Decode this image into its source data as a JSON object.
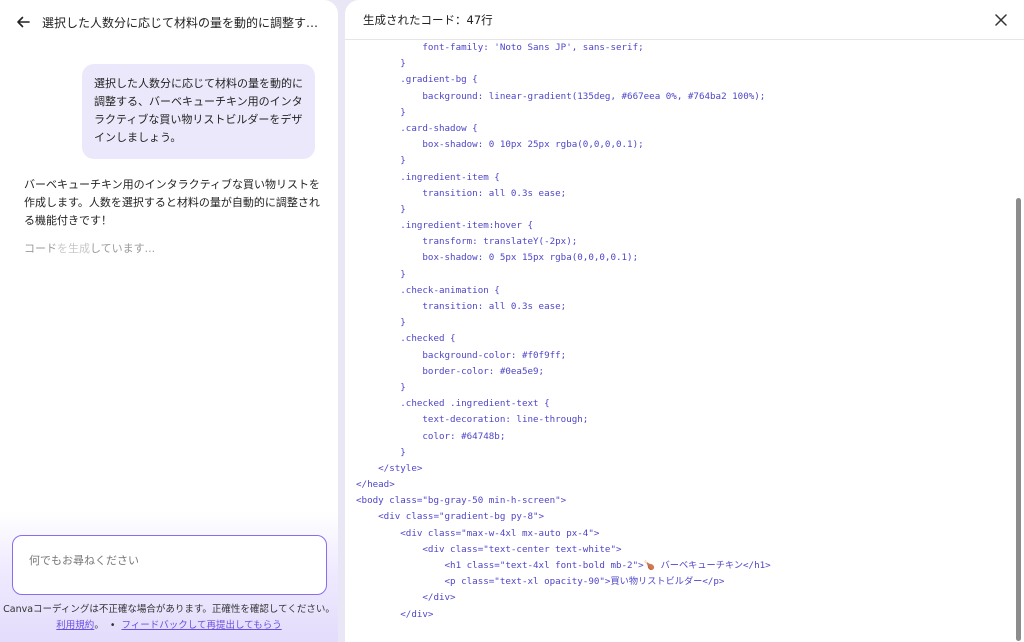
{
  "left": {
    "title": "選択した人数分に応じて材料の量を動的に調整する、バー…",
    "user_message": "選択した人数分に応じて材料の量を動的に調整する、バーベキューチキン用のインタラクティブな買い物リストビルダーをデザインしましょう。",
    "assistant_message": "バーベキューチキン用のインタラクティブな買い物リストを作成します。人数を選択すると材料の量が自動的に調整される機能付きです！",
    "generating_a": "コード",
    "generating_b": "を生成",
    "generating_c": "しています...",
    "input_placeholder": "何でもお尋ねください",
    "disclaimer": "Canvaコーディングは不正確な場合があります。正確性を確認してください。",
    "terms_link": "利用規約",
    "feedback_link": "フィードバックして再提出してもらう"
  },
  "right": {
    "title": "生成されたコード：47行",
    "code_lines": [
      "            font-family: 'Noto Sans JP', sans-serif;",
      "        }",
      "        .gradient-bg {",
      "            background: linear-gradient(135deg, #667eea 0%, #764ba2 100%);",
      "        }",
      "        .card-shadow {",
      "            box-shadow: 0 10px 25px rgba(0,0,0,0.1);",
      "        }",
      "        .ingredient-item {",
      "            transition: all 0.3s ease;",
      "        }",
      "        .ingredient-item:hover {",
      "            transform: translateY(-2px);",
      "            box-shadow: 0 5px 15px rgba(0,0,0,0.1);",
      "        }",
      "        .check-animation {",
      "            transition: all 0.3s ease;",
      "        }",
      "        .checked {",
      "            background-color: #f0f9ff;",
      "            border-color: #0ea5e9;",
      "        }",
      "        .checked .ingredient-text {",
      "            text-decoration: line-through;",
      "            color: #64748b;",
      "        }",
      "    </style>",
      "</head>",
      "<body class=\"bg-gray-50 min-h-screen\">",
      "    <div class=\"gradient-bg py-8\">",
      "        <div class=\"max-w-4xl mx-auto px-4\">",
      "            <div class=\"text-center text-white\">",
      "                <h1 class=\"text-4xl font-bold mb-2\">🍗 バーベキューチキン</h1>",
      "                <p class=\"text-xl opacity-90\">買い物リストビルダー</p>",
      "            </div>",
      "        </div>"
    ]
  }
}
